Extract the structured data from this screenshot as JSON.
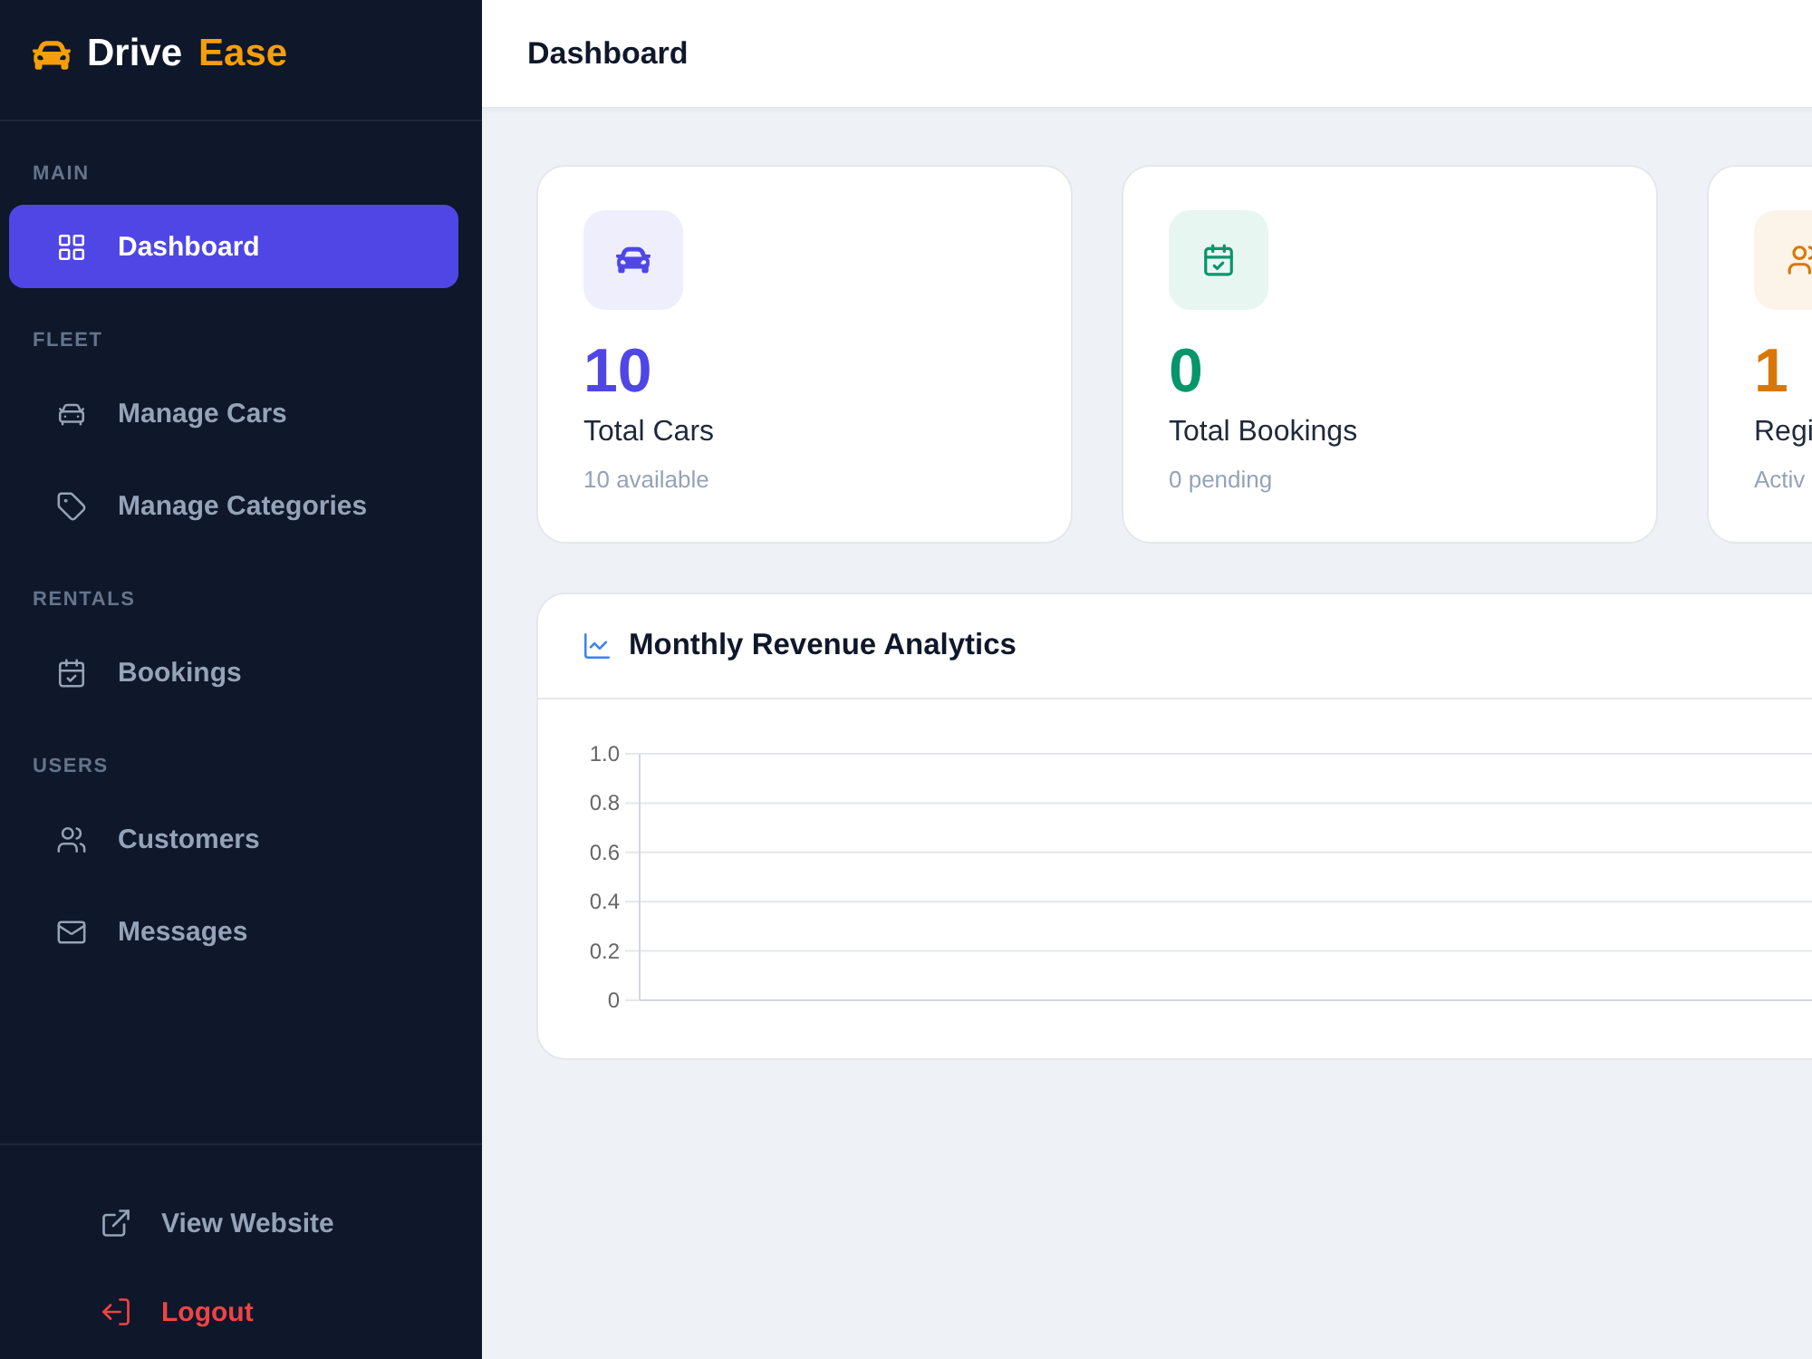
{
  "brand": {
    "name": "Drive",
    "accent": "Ease"
  },
  "sidebar": {
    "sections": [
      {
        "label": "MAIN",
        "items": [
          {
            "label": "Dashboard",
            "selected": true
          }
        ]
      },
      {
        "label": "FLEET",
        "items": [
          {
            "label": "Manage Cars",
            "selected": false
          },
          {
            "label": "Manage Categories",
            "selected": false
          }
        ]
      },
      {
        "label": "RENTALS",
        "items": [
          {
            "label": "Bookings",
            "selected": false
          }
        ]
      },
      {
        "label": "USERS",
        "items": [
          {
            "label": "Customers",
            "selected": false
          },
          {
            "label": "Messages",
            "selected": false
          }
        ]
      }
    ],
    "footer_links": [
      {
        "label": "View Website",
        "kind": "link"
      },
      {
        "label": "Logout",
        "kind": "danger"
      }
    ]
  },
  "header": {
    "title": "Dashboard"
  },
  "stats": [
    {
      "value": "10",
      "title": "Total Cars",
      "subtitle": "10 available",
      "color": "#4f46e5"
    },
    {
      "value": "0",
      "title": "Total Bookings",
      "subtitle": "0 pending",
      "color": "#059669"
    },
    {
      "value": "1",
      "title": "Regi",
      "subtitle": "Activ",
      "color": "#d97706"
    }
  ],
  "revenue_chart": {
    "title": "Monthly Revenue Analytics",
    "y_axis_labels": [
      "1.0",
      "0.8",
      "0.6",
      "0.4",
      "0.2",
      "0"
    ]
  }
}
